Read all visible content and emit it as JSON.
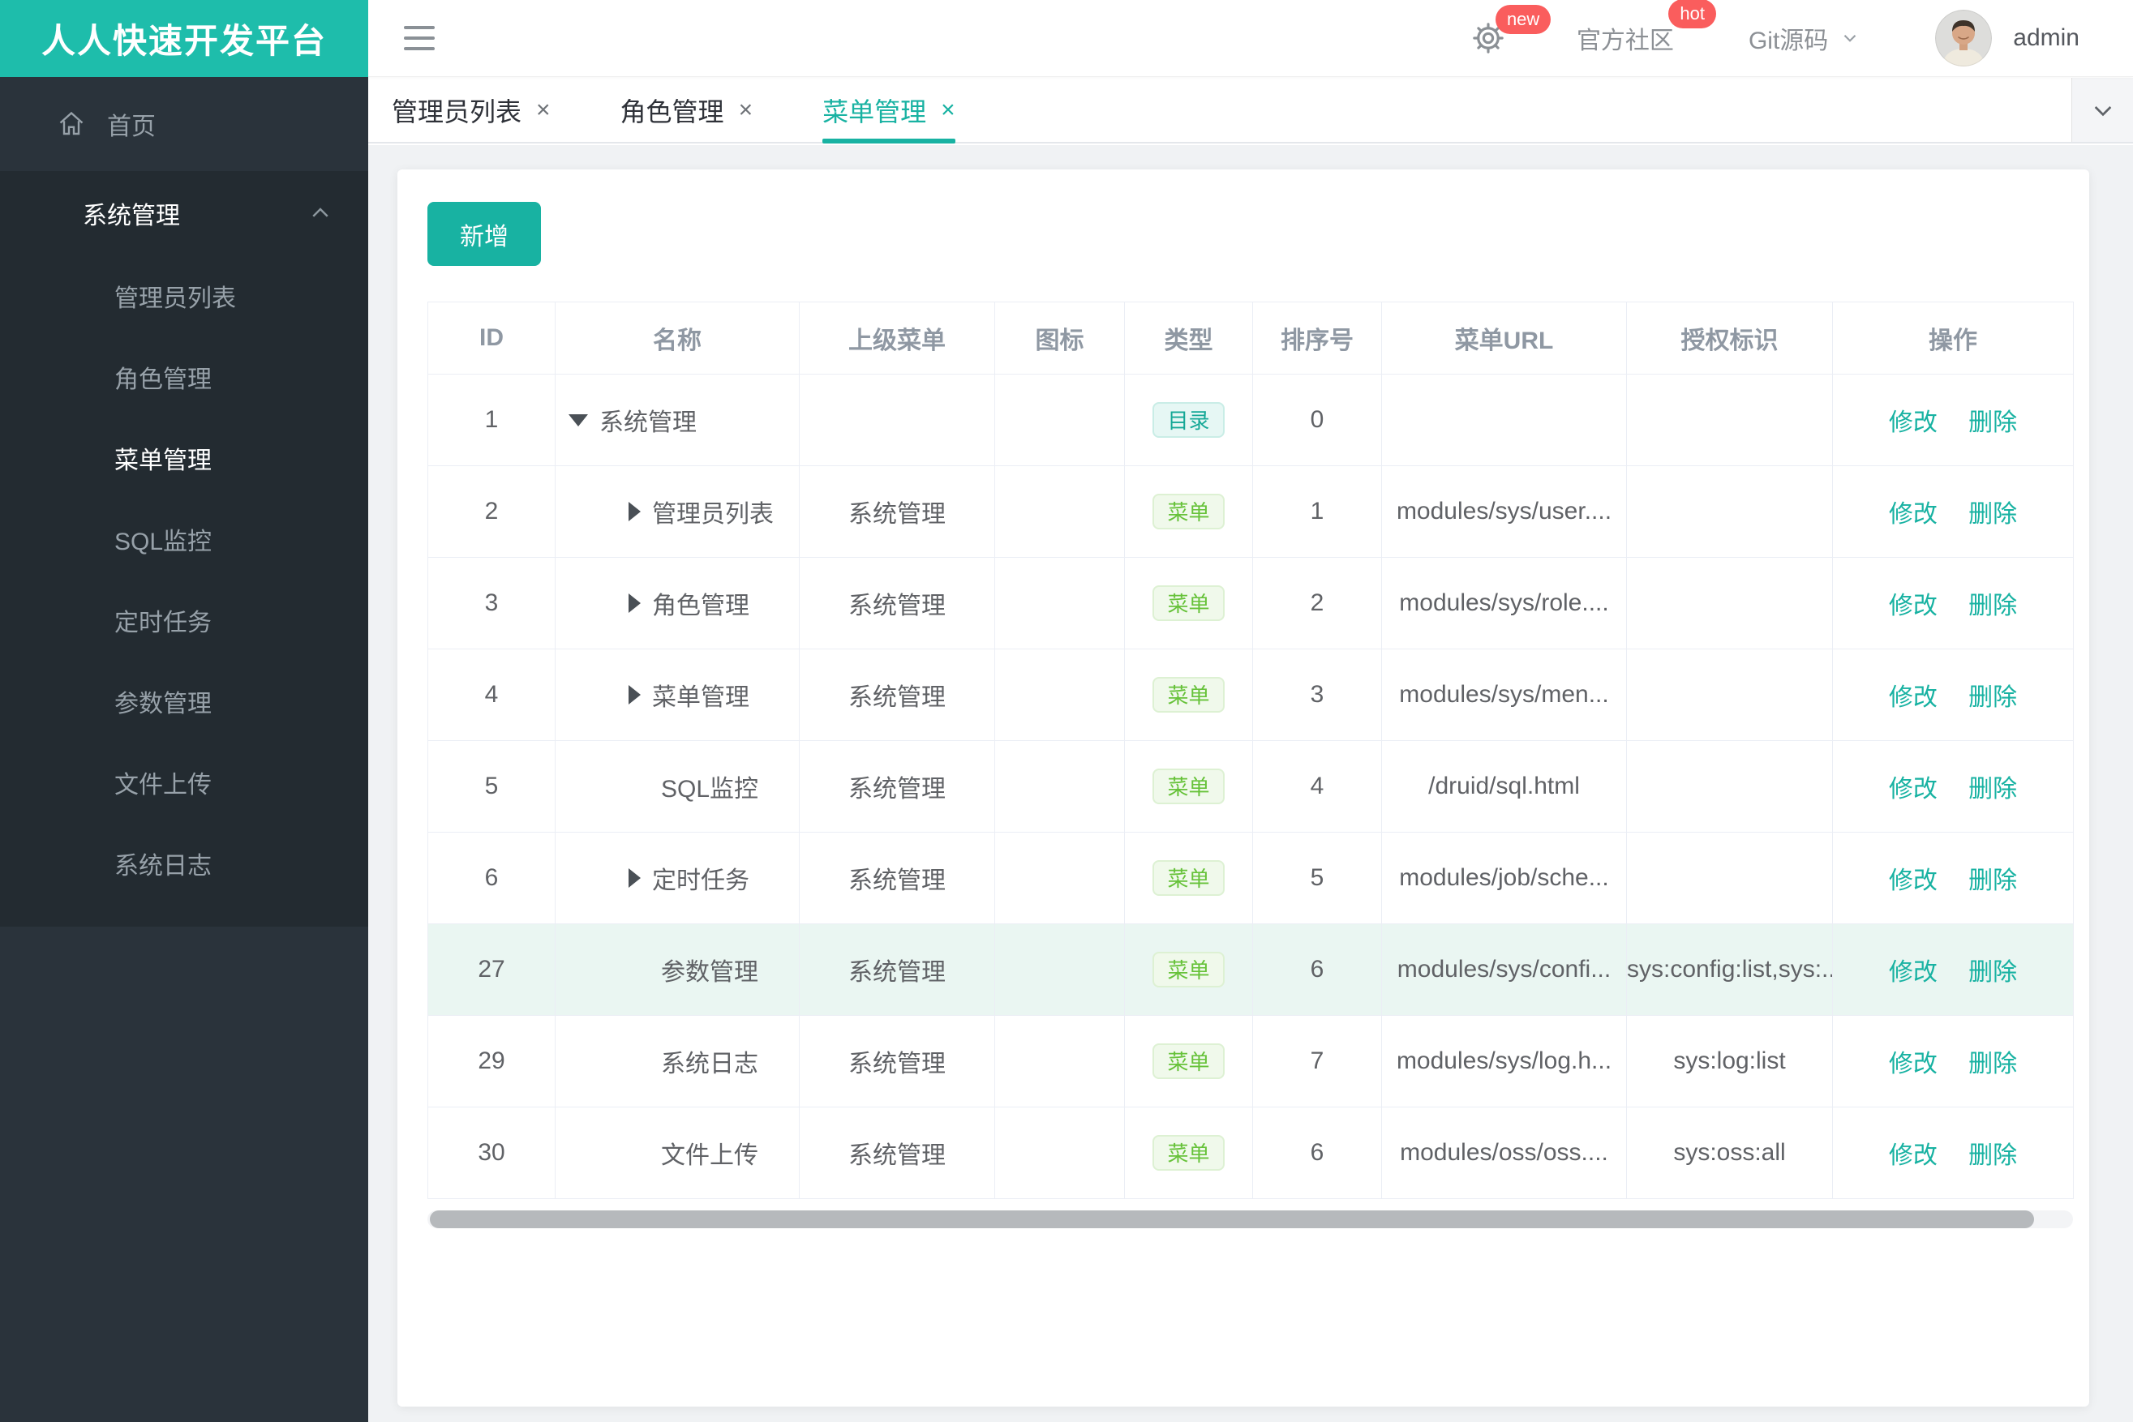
{
  "brand": {
    "title": "人人快速开发平台",
    "color": "#1ebdab"
  },
  "header": {
    "settings_badge": "new",
    "community": {
      "label": "官方社区",
      "badge": "hot"
    },
    "git": {
      "label": "Git源码"
    },
    "user": "admin"
  },
  "sidebar": {
    "home_label": "首页",
    "group": {
      "label": "系统管理",
      "items": [
        "管理员列表",
        "角色管理",
        "菜单管理",
        "SQL监控",
        "定时任务",
        "参数管理",
        "文件上传",
        "系统日志"
      ]
    },
    "active_item": "菜单管理"
  },
  "tabs": {
    "close_glyph": "×",
    "items": [
      {
        "label": "管理员列表",
        "active": false
      },
      {
        "label": "角色管理",
        "active": false
      },
      {
        "label": "菜单管理",
        "active": true
      }
    ]
  },
  "toolbar": {
    "add_label": "新增"
  },
  "table": {
    "columns": [
      "ID",
      "名称",
      "上级菜单",
      "图标",
      "类型",
      "排序号",
      "菜单URL",
      "授权标识",
      "操作"
    ],
    "actions": [
      "修改",
      "删除"
    ],
    "type_colors": {
      "dir_text": "#16a897",
      "menu_text": "#67c23a"
    },
    "highlight_color": "#eaf6f2",
    "rows": [
      {
        "id": "1",
        "name": "系统管理",
        "tree": "root",
        "parent": "",
        "icon": "",
        "type": "目录",
        "type_kind": "dir",
        "sort": "0",
        "url": "",
        "perms": "",
        "highlight": false
      },
      {
        "id": "2",
        "name": "管理员列表",
        "tree": "branch",
        "parent": "系统管理",
        "icon": "",
        "type": "菜单",
        "type_kind": "menu",
        "sort": "1",
        "url": "modules/sys/user....",
        "perms": "",
        "highlight": false
      },
      {
        "id": "3",
        "name": "角色管理",
        "tree": "branch",
        "parent": "系统管理",
        "icon": "",
        "type": "菜单",
        "type_kind": "menu",
        "sort": "2",
        "url": "modules/sys/role....",
        "perms": "",
        "highlight": false
      },
      {
        "id": "4",
        "name": "菜单管理",
        "tree": "branch",
        "parent": "系统管理",
        "icon": "",
        "type": "菜单",
        "type_kind": "menu",
        "sort": "3",
        "url": "modules/sys/men...",
        "perms": "",
        "highlight": false
      },
      {
        "id": "5",
        "name": "SQL监控",
        "tree": "leaf",
        "parent": "系统管理",
        "icon": "",
        "type": "菜单",
        "type_kind": "menu",
        "sort": "4",
        "url": "/druid/sql.html",
        "perms": "",
        "highlight": false
      },
      {
        "id": "6",
        "name": "定时任务",
        "tree": "branch",
        "parent": "系统管理",
        "icon": "",
        "type": "菜单",
        "type_kind": "menu",
        "sort": "5",
        "url": "modules/job/sche...",
        "perms": "",
        "highlight": false
      },
      {
        "id": "27",
        "name": "参数管理",
        "tree": "leaf",
        "parent": "系统管理",
        "icon": "",
        "type": "菜单",
        "type_kind": "menu",
        "sort": "6",
        "url": "modules/sys/confi...",
        "perms": "sys:config:list,sys:..",
        "highlight": true
      },
      {
        "id": "29",
        "name": "系统日志",
        "tree": "leaf",
        "parent": "系统管理",
        "icon": "",
        "type": "菜单",
        "type_kind": "menu",
        "sort": "7",
        "url": "modules/sys/log.h...",
        "perms": "sys:log:list",
        "highlight": false
      },
      {
        "id": "30",
        "name": "文件上传",
        "tree": "leaf",
        "parent": "系统管理",
        "icon": "",
        "type": "菜单",
        "type_kind": "menu",
        "sort": "6",
        "url": "modules/oss/oss....",
        "perms": "sys:oss:all",
        "highlight": false
      }
    ]
  }
}
